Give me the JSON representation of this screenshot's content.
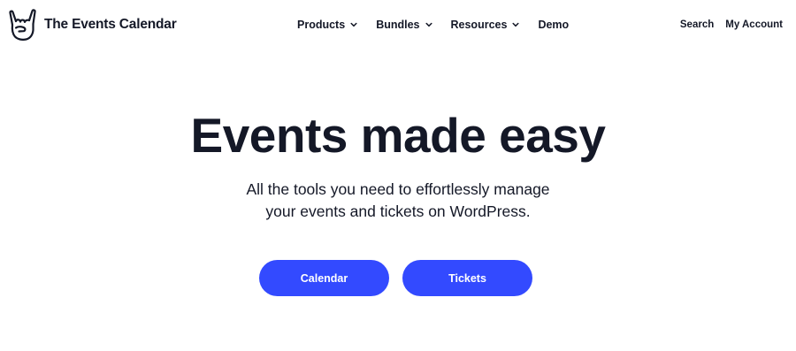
{
  "brand": {
    "name": "The Events Calendar",
    "logo_icon": "rock-hand-icon"
  },
  "main_nav": {
    "items": [
      {
        "label": "Products",
        "has_dropdown": true
      },
      {
        "label": "Bundles",
        "has_dropdown": true
      },
      {
        "label": "Resources",
        "has_dropdown": true
      },
      {
        "label": "Demo",
        "has_dropdown": false
      }
    ]
  },
  "utility_nav": {
    "search_label": "Search",
    "account_label": "My Account"
  },
  "hero": {
    "title": "Events made easy",
    "subtitle_line1": "All the tools you need to effortlessly manage",
    "subtitle_line2": "your events and tickets on WordPress.",
    "buttons": [
      {
        "label": "Calendar"
      },
      {
        "label": "Tickets"
      }
    ]
  },
  "colors": {
    "primary": "#334aff",
    "text": "#141827",
    "background": "#ffffff"
  }
}
